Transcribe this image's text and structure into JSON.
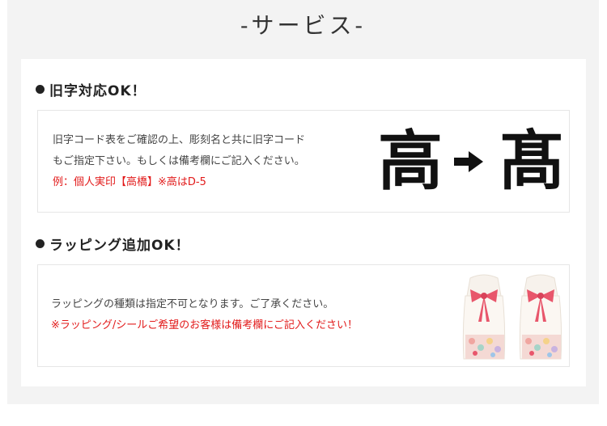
{
  "header": {
    "title": "-サービス-"
  },
  "sections": [
    {
      "title": "旧字対応OK！",
      "lines": [
        "旧字コード表をご確認の上、彫刻名と共に旧字コード",
        "もご指定下さい。もしくは備考欄にご記入ください。"
      ],
      "note": "例：個人実印【高橋】※高はD-5",
      "kanji_before": "高",
      "kanji_after": "髙"
    },
    {
      "title": "ラッピング追加OK！",
      "line": "ラッピングの種類は指定不可となります。ご了承ください。",
      "note": "※ラッピング/シールご希望のお客様は備考欄にご記入ください！"
    }
  ],
  "colors": {
    "accent_red": "#e21b1b",
    "panel_bg": "#f3f3f3",
    "ribbon": "#e8566b"
  },
  "icons": [
    "bullet-dot-icon",
    "arrow-right-icon",
    "gift-bag-image"
  ]
}
